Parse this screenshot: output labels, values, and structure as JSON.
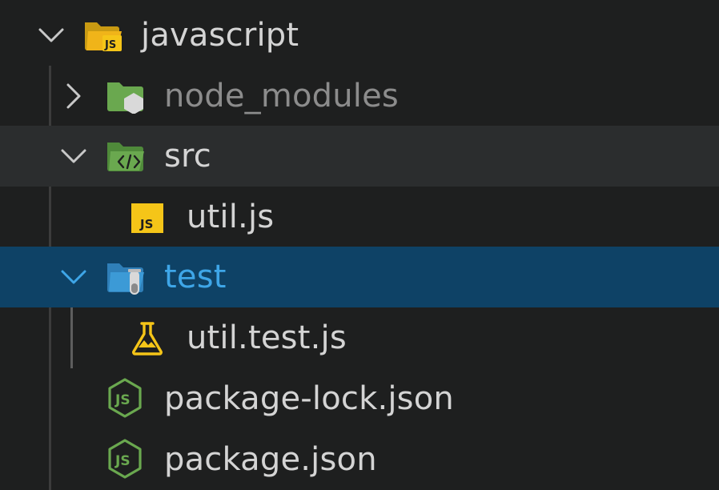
{
  "explorer": {
    "root": {
      "label": "javascript",
      "icon": "javascript-folder-open-icon",
      "expanded": true
    },
    "items": [
      {
        "label": "node_modules",
        "icon": "node-modules-folder-icon",
        "expanded": false,
        "type": "folder",
        "state": "dimmed"
      },
      {
        "label": "src",
        "icon": "src-folder-open-icon",
        "expanded": true,
        "type": "folder",
        "state": "hover"
      },
      {
        "label": "util.js",
        "icon": "js-file-icon",
        "type": "file"
      },
      {
        "label": "test",
        "icon": "test-folder-open-icon",
        "expanded": true,
        "type": "folder",
        "state": "selected"
      },
      {
        "label": "util.test.js",
        "icon": "test-flask-file-icon",
        "type": "file"
      },
      {
        "label": "package-lock.json",
        "icon": "nodejs-file-icon",
        "type": "file"
      },
      {
        "label": "package.json",
        "icon": "nodejs-file-icon",
        "type": "file"
      }
    ]
  },
  "colors": {
    "background": "#1e1f1f",
    "hover_row": "#2b2d2e",
    "selected_row": "#0e4266",
    "selected_text": "#3ea6e8",
    "text": "#d4d4d4",
    "dim_text": "#8c8c8c",
    "js_yellow": "#f5c518",
    "node_green": "#6aa84f"
  }
}
